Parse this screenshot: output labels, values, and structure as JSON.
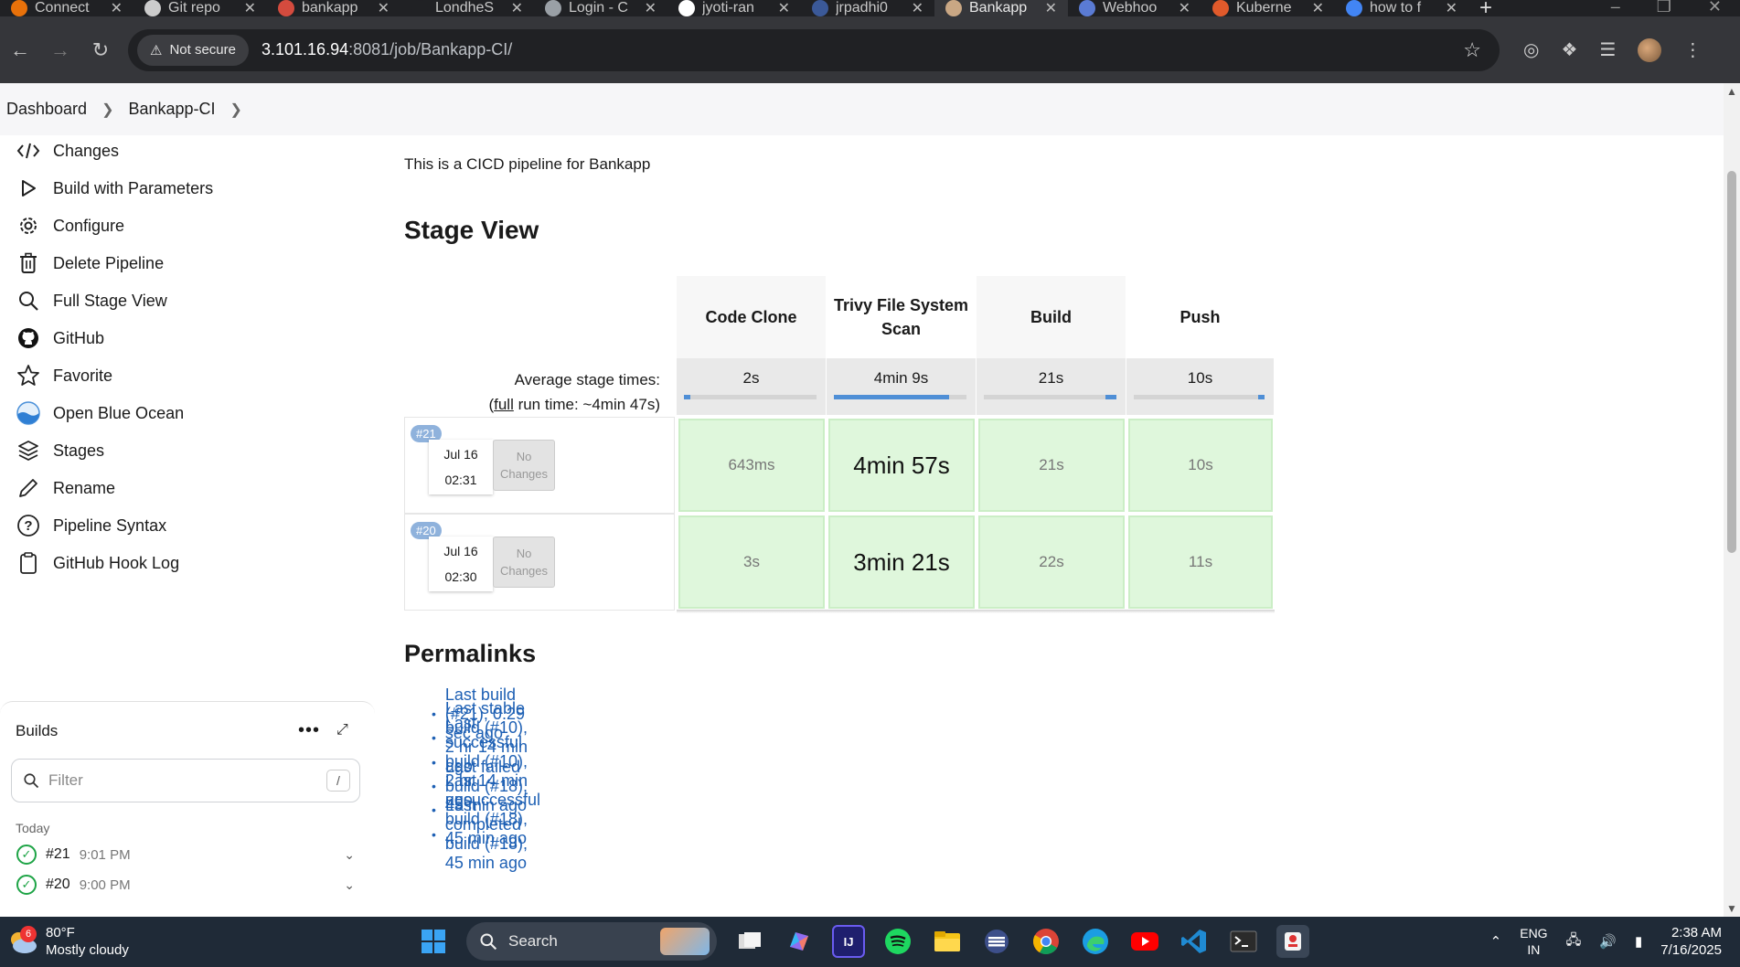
{
  "browser": {
    "tabs": [
      {
        "label": "Connect",
        "color": "#e8710a"
      },
      {
        "label": "Git repo",
        "color": "#cccccc"
      },
      {
        "label": "bankapp",
        "color": "#d44b3e"
      },
      {
        "label": "LondheS",
        "color": "#202124"
      },
      {
        "label": "Login - C",
        "color": "#9aa0a6"
      },
      {
        "label": "jyoti-ran",
        "color": "#ffffff"
      },
      {
        "label": "jrpadhi0",
        "color": "#3b5998"
      },
      {
        "label": "Bankapp",
        "color": "#c9a784"
      },
      {
        "label": "Webhoo",
        "color": "#5a7bd4"
      },
      {
        "label": "Kuberne",
        "color": "#e05a2b"
      },
      {
        "label": "how to f",
        "color": "#4285f4"
      }
    ],
    "security_label": "Not secure",
    "url_host": "3.101.16.94",
    "url_path": ":8081/job/Bankapp-CI/"
  },
  "breadcrumb": {
    "items": [
      "Dashboard",
      "Bankapp-CI"
    ]
  },
  "sidebar": {
    "items": [
      {
        "label": "Changes",
        "icon": "code-icon"
      },
      {
        "label": "Build with Parameters",
        "icon": "play-icon"
      },
      {
        "label": "Configure",
        "icon": "gear-icon"
      },
      {
        "label": "Delete Pipeline",
        "icon": "trash-icon"
      },
      {
        "label": "Full Stage View",
        "icon": "search-icon"
      },
      {
        "label": "GitHub",
        "icon": "github-icon"
      },
      {
        "label": "Favorite",
        "icon": "star-icon"
      },
      {
        "label": "Open Blue Ocean",
        "icon": "blue-ocean-icon"
      },
      {
        "label": "Stages",
        "icon": "layers-icon"
      },
      {
        "label": "Rename",
        "icon": "pencil-icon"
      },
      {
        "label": "Pipeline Syntax",
        "icon": "help-icon"
      },
      {
        "label": "GitHub Hook Log",
        "icon": "clipboard-icon"
      }
    ]
  },
  "builds": {
    "title": "Builds",
    "filter_placeholder": "Filter",
    "filter_shortcut": "/",
    "group": "Today",
    "rows": [
      {
        "number": "#21",
        "time": "9:01 PM"
      },
      {
        "number": "#20",
        "time": "9:00 PM"
      }
    ]
  },
  "main": {
    "description": "This is a CICD pipeline for Bankapp",
    "stage_view_title": "Stage View",
    "permalinks_title": "Permalinks"
  },
  "stage_view": {
    "stages": [
      {
        "name": "Code Clone",
        "avg": "2s",
        "avg_fraction": 0.01
      },
      {
        "name": "Trivy File System Scan",
        "avg": "4min 9s",
        "avg_fraction": 0.87
      },
      {
        "name": "Build",
        "avg": "21s",
        "avg_fraction": 0.08
      },
      {
        "name": "Push",
        "avg": "10s",
        "avg_fraction": 0.04
      }
    ],
    "avg_label": "Average stage times:",
    "full_run_prefix": "(",
    "full_link": "full",
    "full_run_suffix": " run time: ~4min 47s)",
    "runs": [
      {
        "badge": "#21",
        "date": "Jul 16",
        "time": "02:31",
        "changes": "No Changes",
        "cells": [
          "643ms",
          "4min 57s",
          "21s",
          "10s"
        ]
      },
      {
        "badge": "#20",
        "date": "Jul 16",
        "time": "02:30",
        "changes": "No Changes",
        "cells": [
          "3s",
          "3min 21s",
          "22s",
          "11s"
        ]
      }
    ]
  },
  "permalinks": [
    "Last build (#21), 0.29 sec ago",
    "Last stable build (#10), 2 hr 14 min ago",
    "Last successful build (#10), 2 hr 14 min ago",
    "Last failed build (#18), 45 min ago",
    "Last unsuccessful build (#18), 45 min ago",
    "Last completed build (#18), 45 min ago"
  ],
  "taskbar": {
    "temperature": "80°F",
    "weather": "Mostly cloudy",
    "weather_badge": "6",
    "search_label": "Search",
    "lang_top": "ENG",
    "lang_bottom": "IN",
    "time": "2:38 AM",
    "date": "7/16/2025"
  }
}
